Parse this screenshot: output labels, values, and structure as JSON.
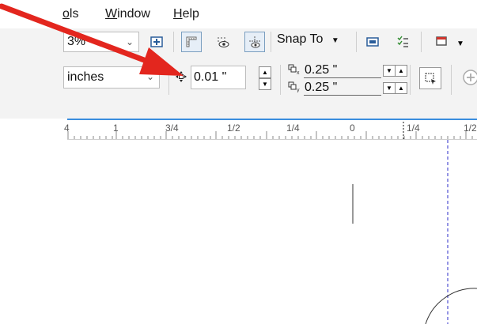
{
  "menu": {
    "tools_partial": "ools",
    "tools_first_partial": "o",
    "window_first": "W",
    "window_rest": "indow",
    "help_first": "H",
    "help_rest": "elp"
  },
  "toolbar1": {
    "zoom_value": "3%",
    "snap_label": "Snap To"
  },
  "toolbar2": {
    "units_value": "inches",
    "nudge_value": "0.01 \"",
    "dup_x_value": "0.25 \"",
    "dup_y_value": "0.25 \""
  },
  "ruler": {
    "labels": [
      "4",
      "1",
      "3/4",
      "1/2",
      "1/4",
      "0",
      "1/4",
      "1/2"
    ]
  },
  "colors": {
    "arrow": "#e3261e",
    "ruler_accent": "#3a8dde",
    "guide": "#2b2bc8"
  }
}
